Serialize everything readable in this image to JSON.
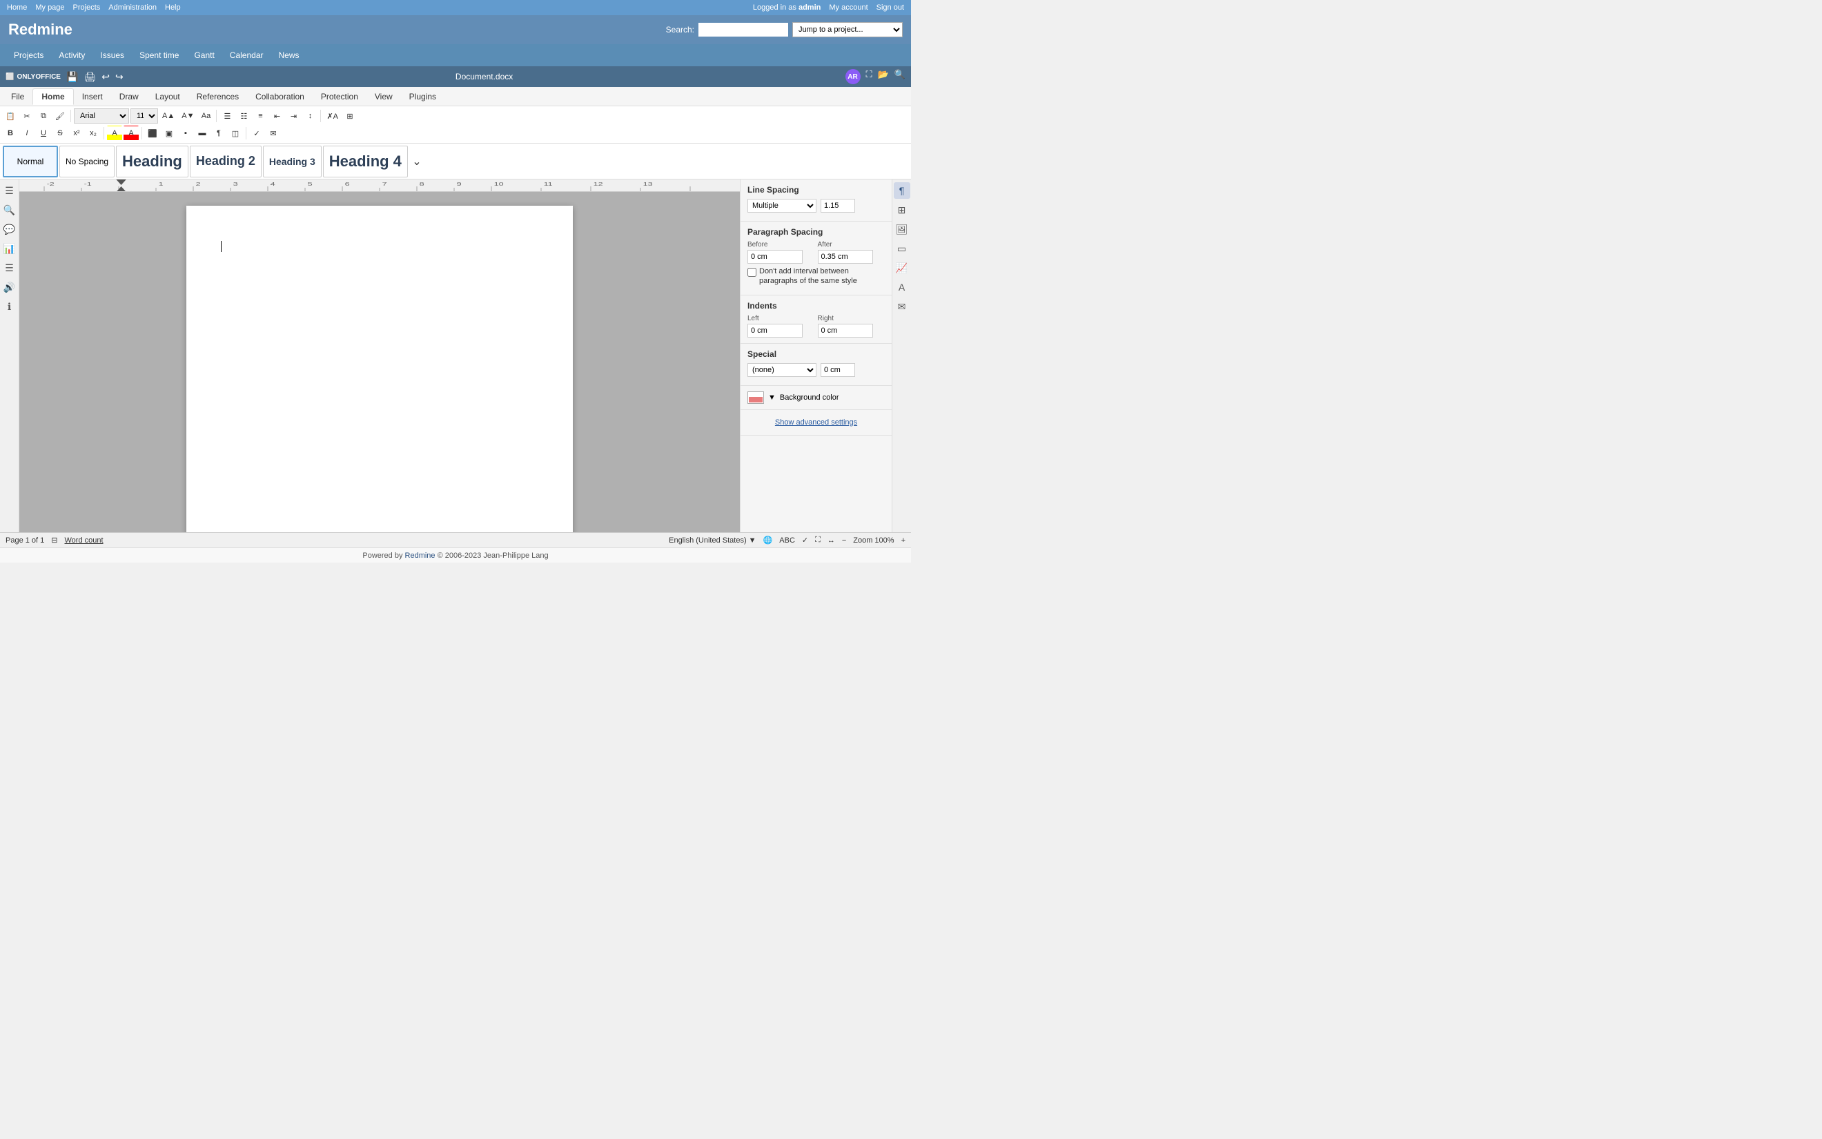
{
  "redmine": {
    "topnav": {
      "home": "Home",
      "mypage": "My page",
      "projects": "Projects",
      "administration": "Administration",
      "help": "Help",
      "logged_in_as": "Logged in as",
      "admin": "admin",
      "my_account": "My account",
      "sign_out": "Sign out"
    },
    "logo": "Redmine",
    "search_label": "Search:",
    "search_placeholder": "",
    "jump_to_project": "Jump to a project...",
    "nav": {
      "projects": "Projects",
      "activity": "Activity",
      "issues": "Issues",
      "spent_time": "Spent time",
      "gantt": "Gantt",
      "calendar": "Calendar",
      "news": "News"
    },
    "footer": "Powered by Redmine © 2006-2023 Jean-Philippe Lang"
  },
  "editor": {
    "title": "Document.docx",
    "logo": "ONLYOFFICE",
    "menubar": {
      "tabs": [
        "File",
        "Home",
        "Insert",
        "Draw",
        "Layout",
        "References",
        "Collaboration",
        "Protection",
        "View",
        "Plugins"
      ],
      "active": "Home"
    },
    "toolbar": {
      "font": "Arial",
      "font_size": "11",
      "bold": "B",
      "italic": "I",
      "underline": "U",
      "strikethrough": "S",
      "superscript": "x²",
      "subscript": "x₂"
    },
    "styles": [
      {
        "id": "normal",
        "label": "Normal",
        "active": true
      },
      {
        "id": "no-spacing",
        "label": "No Spacing",
        "active": false
      },
      {
        "id": "heading1",
        "label": "Heading",
        "active": false,
        "class": "heading1"
      },
      {
        "id": "heading2",
        "label": "Heading 2",
        "active": false,
        "class": "heading2"
      },
      {
        "id": "heading3",
        "label": "Heading 3",
        "active": false,
        "class": "heading3"
      },
      {
        "id": "heading4",
        "label": "Heading 4",
        "active": false,
        "class": "heading4"
      }
    ],
    "right_panel": {
      "line_spacing_title": "Line Spacing",
      "line_spacing_type": "Multiple",
      "line_spacing_value": "1.15",
      "paragraph_spacing_title": "Paragraph Spacing",
      "before_label": "Before",
      "before_value": "0 cm",
      "after_label": "After",
      "after_value": "0.35 cm",
      "no_interval_label": "Don't add interval between paragraphs of the same style",
      "indents_title": "Indents",
      "left_label": "Left",
      "left_value": "0 cm",
      "right_label": "Right",
      "right_value": "0 cm",
      "special_title": "Special",
      "special_value": "(none)",
      "special_offset": "0 cm",
      "bg_color_label": "Background color",
      "show_advanced": "Show advanced settings"
    },
    "statusbar": {
      "page_info": "Page 1 of 1",
      "word_count": "Word count",
      "language": "English (United States)",
      "zoom_label": "Zoom 100%"
    }
  }
}
